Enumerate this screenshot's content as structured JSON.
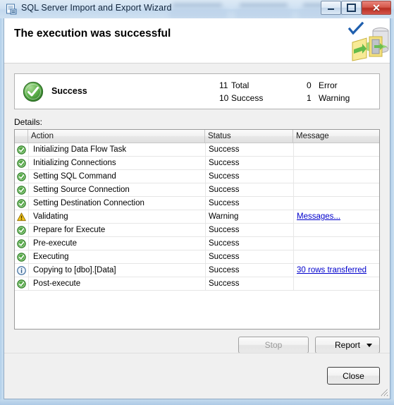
{
  "window": {
    "title": "SQL Server Import and Export Wizard",
    "icon": "wizard-icon",
    "minimize_label": "Minimize",
    "maximize_label": "Maximize",
    "close_label": "✕"
  },
  "banner": {
    "heading": "The execution was successful",
    "check_icon": "blue-checkmark-icon",
    "art_icon": "import-export-graphic"
  },
  "summary": {
    "icon": "success-circle-icon",
    "label": "Success",
    "stats": [
      {
        "num": "11",
        "text": "Total"
      },
      {
        "num": "10",
        "text": "Success"
      },
      {
        "num": "0",
        "text": "Error"
      },
      {
        "num": "1",
        "text": "Warning"
      }
    ]
  },
  "details": {
    "label": "Details:",
    "columns": [
      "",
      "Action",
      "Status",
      "Message"
    ],
    "rows": [
      {
        "icon": "success",
        "action": "Initializing Data Flow Task",
        "status": "Success",
        "message": "",
        "link": false
      },
      {
        "icon": "success",
        "action": "Initializing Connections",
        "status": "Success",
        "message": "",
        "link": false
      },
      {
        "icon": "success",
        "action": "Setting SQL Command",
        "status": "Success",
        "message": "",
        "link": false
      },
      {
        "icon": "success",
        "action": "Setting Source Connection",
        "status": "Success",
        "message": "",
        "link": false
      },
      {
        "icon": "success",
        "action": "Setting Destination Connection",
        "status": "Success",
        "message": "",
        "link": false
      },
      {
        "icon": "warning",
        "action": "Validating",
        "status": "Warning",
        "message": "Messages...",
        "link": true
      },
      {
        "icon": "success",
        "action": "Prepare for Execute",
        "status": "Success",
        "message": "",
        "link": false
      },
      {
        "icon": "success",
        "action": "Pre-execute",
        "status": "Success",
        "message": "",
        "link": false
      },
      {
        "icon": "success",
        "action": "Executing",
        "status": "Success",
        "message": "",
        "link": false
      },
      {
        "icon": "info",
        "action": "Copying to [dbo].[Data]",
        "status": "Success",
        "message": "30 rows transferred",
        "link": true
      },
      {
        "icon": "success",
        "action": "Post-execute",
        "status": "Success",
        "message": "",
        "link": false
      }
    ]
  },
  "buttons": {
    "stop": "Stop",
    "report": "Report",
    "report_caret": "chevron-down-icon",
    "close": "Close"
  },
  "colors": {
    "link": "#0000cc",
    "success_green": "#3d9b33",
    "warning_yellow": "#f0c020",
    "info_blue": "#4a7fbf",
    "close_red": "#c0392b",
    "glass_blue": "#b9d4ec"
  }
}
